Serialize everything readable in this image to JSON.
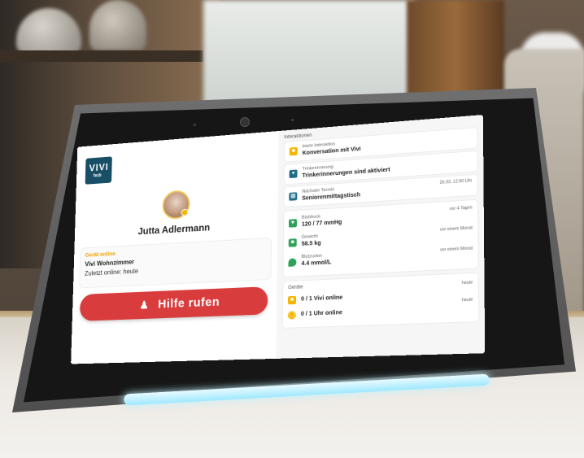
{
  "app": {
    "logo_main": "VIVI",
    "logo_sub": "hub"
  },
  "profile": {
    "name": "Jutta Adlermann"
  },
  "device": {
    "status": "Gerät online",
    "name": "Vivi Wohnzimmer",
    "last_online": "Zuletzt online: heute"
  },
  "help_button": {
    "label": "Hilfe rufen",
    "icon": "bell-alarm-icon"
  },
  "interactions": {
    "title": "Interaktionen",
    "items": [
      {
        "label": "letzte Interaktion",
        "value": "Konversation mit Vivi",
        "icon": "chat-icon"
      },
      {
        "label": "Trinkerinnerung",
        "value": "Trinkerinnerungen sind aktiviert",
        "icon": "cup-icon"
      },
      {
        "label": "Nächster Termin",
        "value": "Seniorenmittagstisch",
        "meta": "26.03. 12:00 Uhr",
        "icon": "calendar-icon"
      }
    ]
  },
  "vitals": {
    "items": [
      {
        "label": "Blutdruck",
        "value": "120 / 77 mmHg",
        "meta": "vor 4 Tagen",
        "icon": "heart-pulse-icon"
      },
      {
        "label": "Gewicht",
        "value": "58.5 kg",
        "meta": "vor einem Monat",
        "icon": "scale-icon"
      },
      {
        "label": "Blutzucker",
        "value": "4.4 mmol/L",
        "meta": "vor einem Monat",
        "icon": "drop-icon"
      }
    ]
  },
  "devices": {
    "title": "Geräte",
    "items": [
      {
        "value": "0 / 1 Vivi online",
        "meta": "heute",
        "icon": "vivi-device-icon"
      },
      {
        "value": "0 / 1 Uhr online",
        "meta": "heute",
        "icon": "watch-icon"
      }
    ]
  },
  "colors": {
    "accent_red": "#d93c3c",
    "brand_teal": "#184e66",
    "status_yellow": "#f5b500",
    "vital_green": "#2fa25a"
  }
}
